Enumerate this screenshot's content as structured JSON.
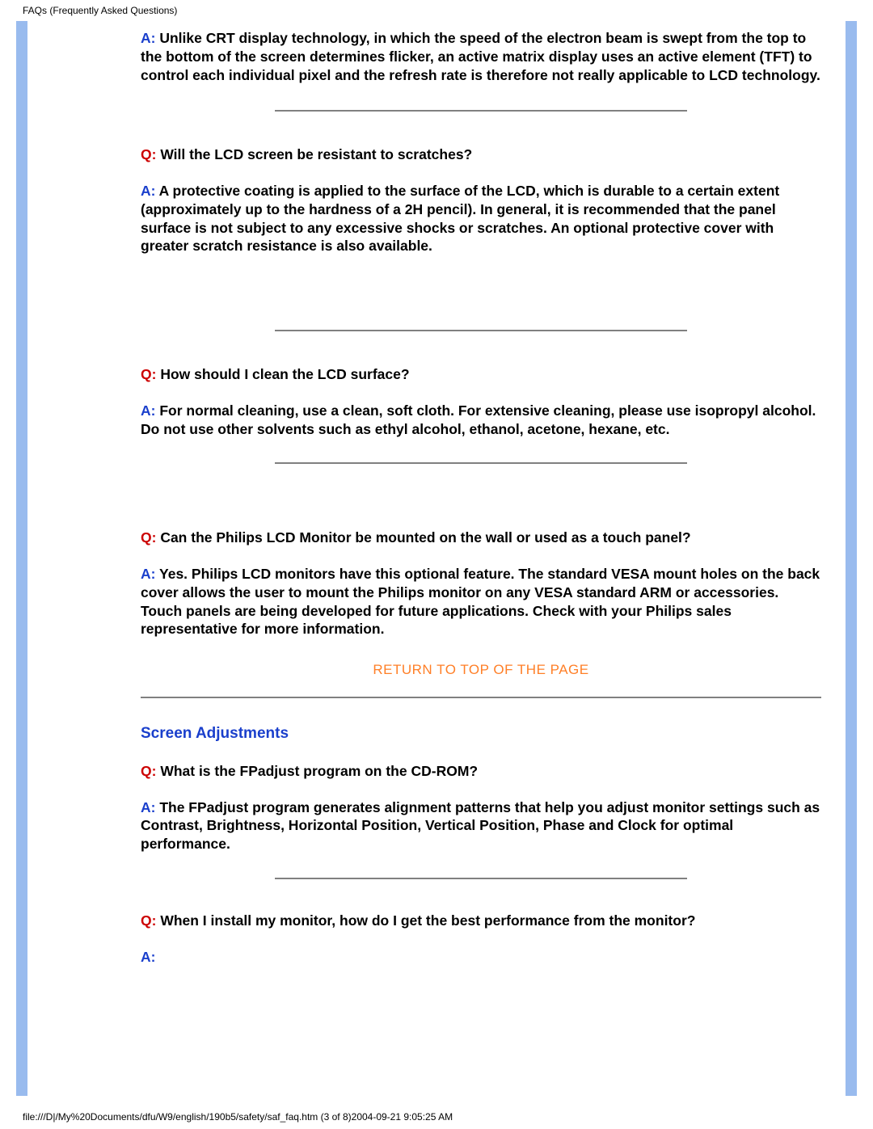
{
  "header": "FAQs (Frequently Asked Questions)",
  "footer": "file:///D|/My%20Documents/dfu/W9/english/190b5/safety/saf_faq.htm (3 of 8)2004-09-21 9:05:25 AM",
  "a0": {
    "a_label": "A:",
    "a_text": " Unlike CRT display technology, in which the speed of the electron beam is swept from the top to the bottom of the screen determines flicker, an active matrix display uses an active element (TFT) to control each individual pixel and the refresh rate is therefore not really applicable to LCD technology."
  },
  "q1": {
    "q_label": "Q:",
    "q_text": " Will the LCD screen be resistant to scratches?",
    "a_label": "A:",
    "a_text": " A protective coating is applied to the surface of the LCD, which is durable to a certain extent (approximately up to the hardness of a 2H pencil). In general, it is recommended that the panel surface is not subject to any excessive shocks or scratches. An optional protective cover with greater scratch resistance is also available."
  },
  "q2": {
    "q_label": "Q:",
    "q_text": " How should I clean the LCD surface?",
    "a_label": "A:",
    "a_text": " For normal cleaning, use a clean, soft cloth. For extensive cleaning, please use isopropyl alcohol. Do not use other solvents such as ethyl alcohol, ethanol, acetone, hexane, etc."
  },
  "q3": {
    "q_label": "Q:",
    "q_text": " Can the Philips LCD Monitor be mounted on the wall or used as a touch panel?",
    "a_label": "A:",
    "a_text": " Yes. Philips LCD monitors have this optional feature. The standard VESA mount holes on the back cover allows the user to mount the Philips monitor on any VESA standard ARM or accessories. Touch panels are being developed for future applications. Check with your Philips sales representative for more information."
  },
  "return_link": "RETURN TO TOP OF THE PAGE",
  "section_heading": "Screen Adjustments",
  "q4": {
    "q_label": "Q:",
    "q_text": " What is the FPadjust program on the CD-ROM?",
    "a_label": "A:",
    "a_text": " The FPadjust program generates alignment patterns that help you adjust monitor settings such as Contrast, Brightness, Horizontal Position, Vertical Position, Phase and Clock for optimal performance."
  },
  "q5": {
    "q_label": "Q:",
    "q_text": " When I install my monitor, how do I get the best performance from the monitor?",
    "a_label": "A:"
  }
}
